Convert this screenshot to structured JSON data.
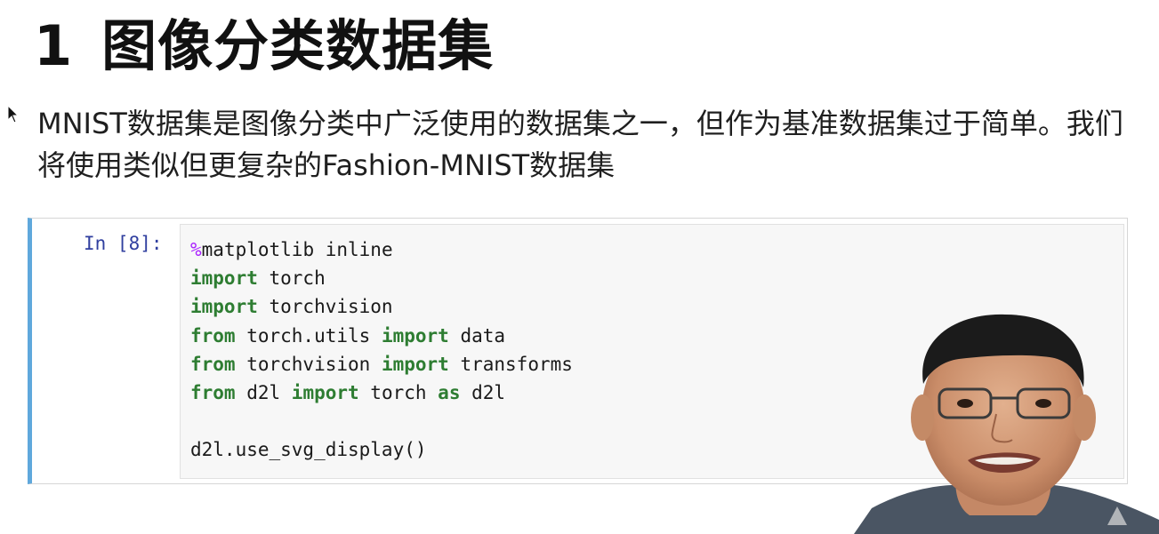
{
  "heading": {
    "number": "1",
    "title": "图像分类数据集"
  },
  "intro": {
    "text": "MNIST数据集是图像分类中广泛使用的数据集之一，但作为基准数据集过于简单。我们将使用类似但更复杂的Fashion-MNIST数据集"
  },
  "cell": {
    "prompt": "In [8]:",
    "lines": [
      {
        "parts": [
          {
            "t": "%",
            "c": "magic"
          },
          {
            "t": "matplotlib inline",
            "c": "plain"
          }
        ]
      },
      {
        "parts": [
          {
            "t": "import",
            "c": "kw"
          },
          {
            "t": " torch",
            "c": "plain"
          }
        ]
      },
      {
        "parts": [
          {
            "t": "import",
            "c": "kw"
          },
          {
            "t": " torchvision",
            "c": "plain"
          }
        ]
      },
      {
        "parts": [
          {
            "t": "from",
            "c": "kw"
          },
          {
            "t": " torch.utils ",
            "c": "plain"
          },
          {
            "t": "import",
            "c": "kw"
          },
          {
            "t": " data",
            "c": "plain"
          }
        ]
      },
      {
        "parts": [
          {
            "t": "from",
            "c": "kw"
          },
          {
            "t": " torchvision ",
            "c": "plain"
          },
          {
            "t": "import",
            "c": "kw"
          },
          {
            "t": " transforms",
            "c": "plain"
          }
        ]
      },
      {
        "parts": [
          {
            "t": "from",
            "c": "kw"
          },
          {
            "t": " d2l ",
            "c": "plain"
          },
          {
            "t": "import",
            "c": "kw"
          },
          {
            "t": " torch ",
            "c": "plain"
          },
          {
            "t": "as",
            "c": "kw"
          },
          {
            "t": " d2l",
            "c": "plain"
          }
        ]
      },
      {
        "parts": []
      },
      {
        "parts": [
          {
            "t": "d2l.use_svg_display()",
            "c": "plain"
          }
        ]
      }
    ]
  },
  "icons": {
    "cursor": "mouse-pointer-icon",
    "watermark": "triangle-watermark-icon"
  },
  "colors": {
    "cell_border_accent": "#5fa8dc",
    "prompt": "#303f9f",
    "keyword": "#2e7d32",
    "magic": "#aa22ff"
  }
}
